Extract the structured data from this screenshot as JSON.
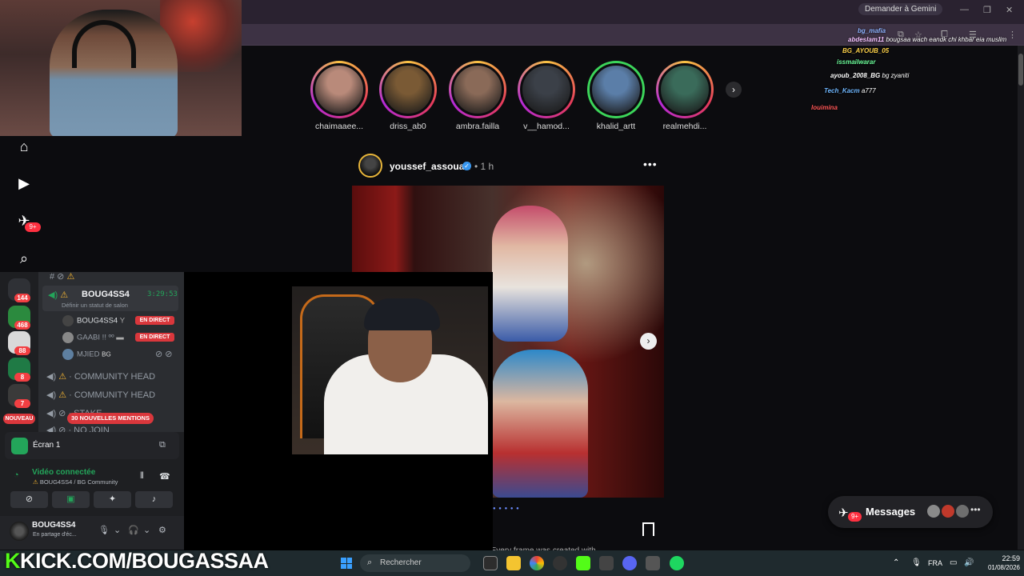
{
  "browser": {
    "gemini_button": "Demander à Gemini"
  },
  "stories": [
    {
      "name": "chaimaaee...",
      "color": "#b98a7a",
      "close_friend": false
    },
    {
      "name": "driss_ab0",
      "color": "#7a5a35",
      "close_friend": false
    },
    {
      "name": "ambra.failla",
      "color": "#8a6a58",
      "close_friend": false
    },
    {
      "name": "v__hamod...",
      "color": "#3b4048",
      "close_friend": false
    },
    {
      "name": "khalid_artt",
      "color": "#5b7ea8",
      "close_friend": true
    },
    {
      "name": "realmehdi...",
      "color": "#3a6b5a",
      "close_friend": false
    }
  ],
  "post": {
    "username": "youssef_assouari",
    "time": "• 1 h",
    "more": "•••",
    "caption_peek": "youssef_assouari • ...votre copine ... Every frame was created with..."
  },
  "messages": {
    "label": "Messages",
    "badge": "9+"
  },
  "nav": {
    "badge": "9+"
  },
  "discord": {
    "servers": [
      {
        "badge": "144",
        "color": "#2f3136"
      },
      {
        "badge": "468",
        "color": "#2b8a3e"
      },
      {
        "badge": "88",
        "color": "#d9d9d9"
      },
      {
        "badge": "8",
        "color": "#1f7a45"
      },
      {
        "badge": "7",
        "color": "#3a3a3a"
      }
    ],
    "channel_name": "BOUG4SS4",
    "channel_time": "3:29:53",
    "channel_status": "Définir un statut de salon",
    "users": [
      {
        "name": "BOUG4SS4",
        "tag": "Y",
        "live": "EN DIRECT",
        "color": "#444"
      },
      {
        "name": "GAABI !! ºº",
        "tag": "",
        "live": "EN DIRECT",
        "color": "#888"
      },
      {
        "name": "MJIED",
        "tag": "BG",
        "live": "",
        "color": "#5e7fa0"
      }
    ],
    "other_channels": [
      "COMMUNITY HEAD",
      "COMMUNITY HEAD",
      "STAKE",
      "NO JOIN"
    ],
    "mentions": "30 NOUVELLES MENTIONS",
    "nouveau": "NOUVEAU",
    "screen_label": "Écran 1",
    "video_label": "Vidéo connectée",
    "video_sub": "BOUG4SS4 / BG Community",
    "user_name": "BOUG4SS4",
    "user_status": "En partage d'éc..."
  },
  "chat": [
    {
      "user": "bg_mafia",
      "text": ""
    },
    {
      "user": "abdeslam11",
      "text": "bougsaa wach eandk chi khbar eia muslim"
    },
    {
      "user": "BG_AYOUB_05",
      "text": ""
    },
    {
      "user": "issmailwarar",
      "text": ""
    },
    {
      "user": "ayoub_2008_BG",
      "text": "bg zyaniti"
    },
    {
      "user": "Tech_Kacm",
      "text": "a777"
    },
    {
      "user": "louimina",
      "text": ""
    }
  ],
  "taskbar": {
    "kick_k": "K",
    "kick_rest": "KICK.COM/BOUGASSAA",
    "search_label": "Rechercher",
    "lang": "FRA",
    "time": "22:59",
    "date": "01/08/2026"
  }
}
